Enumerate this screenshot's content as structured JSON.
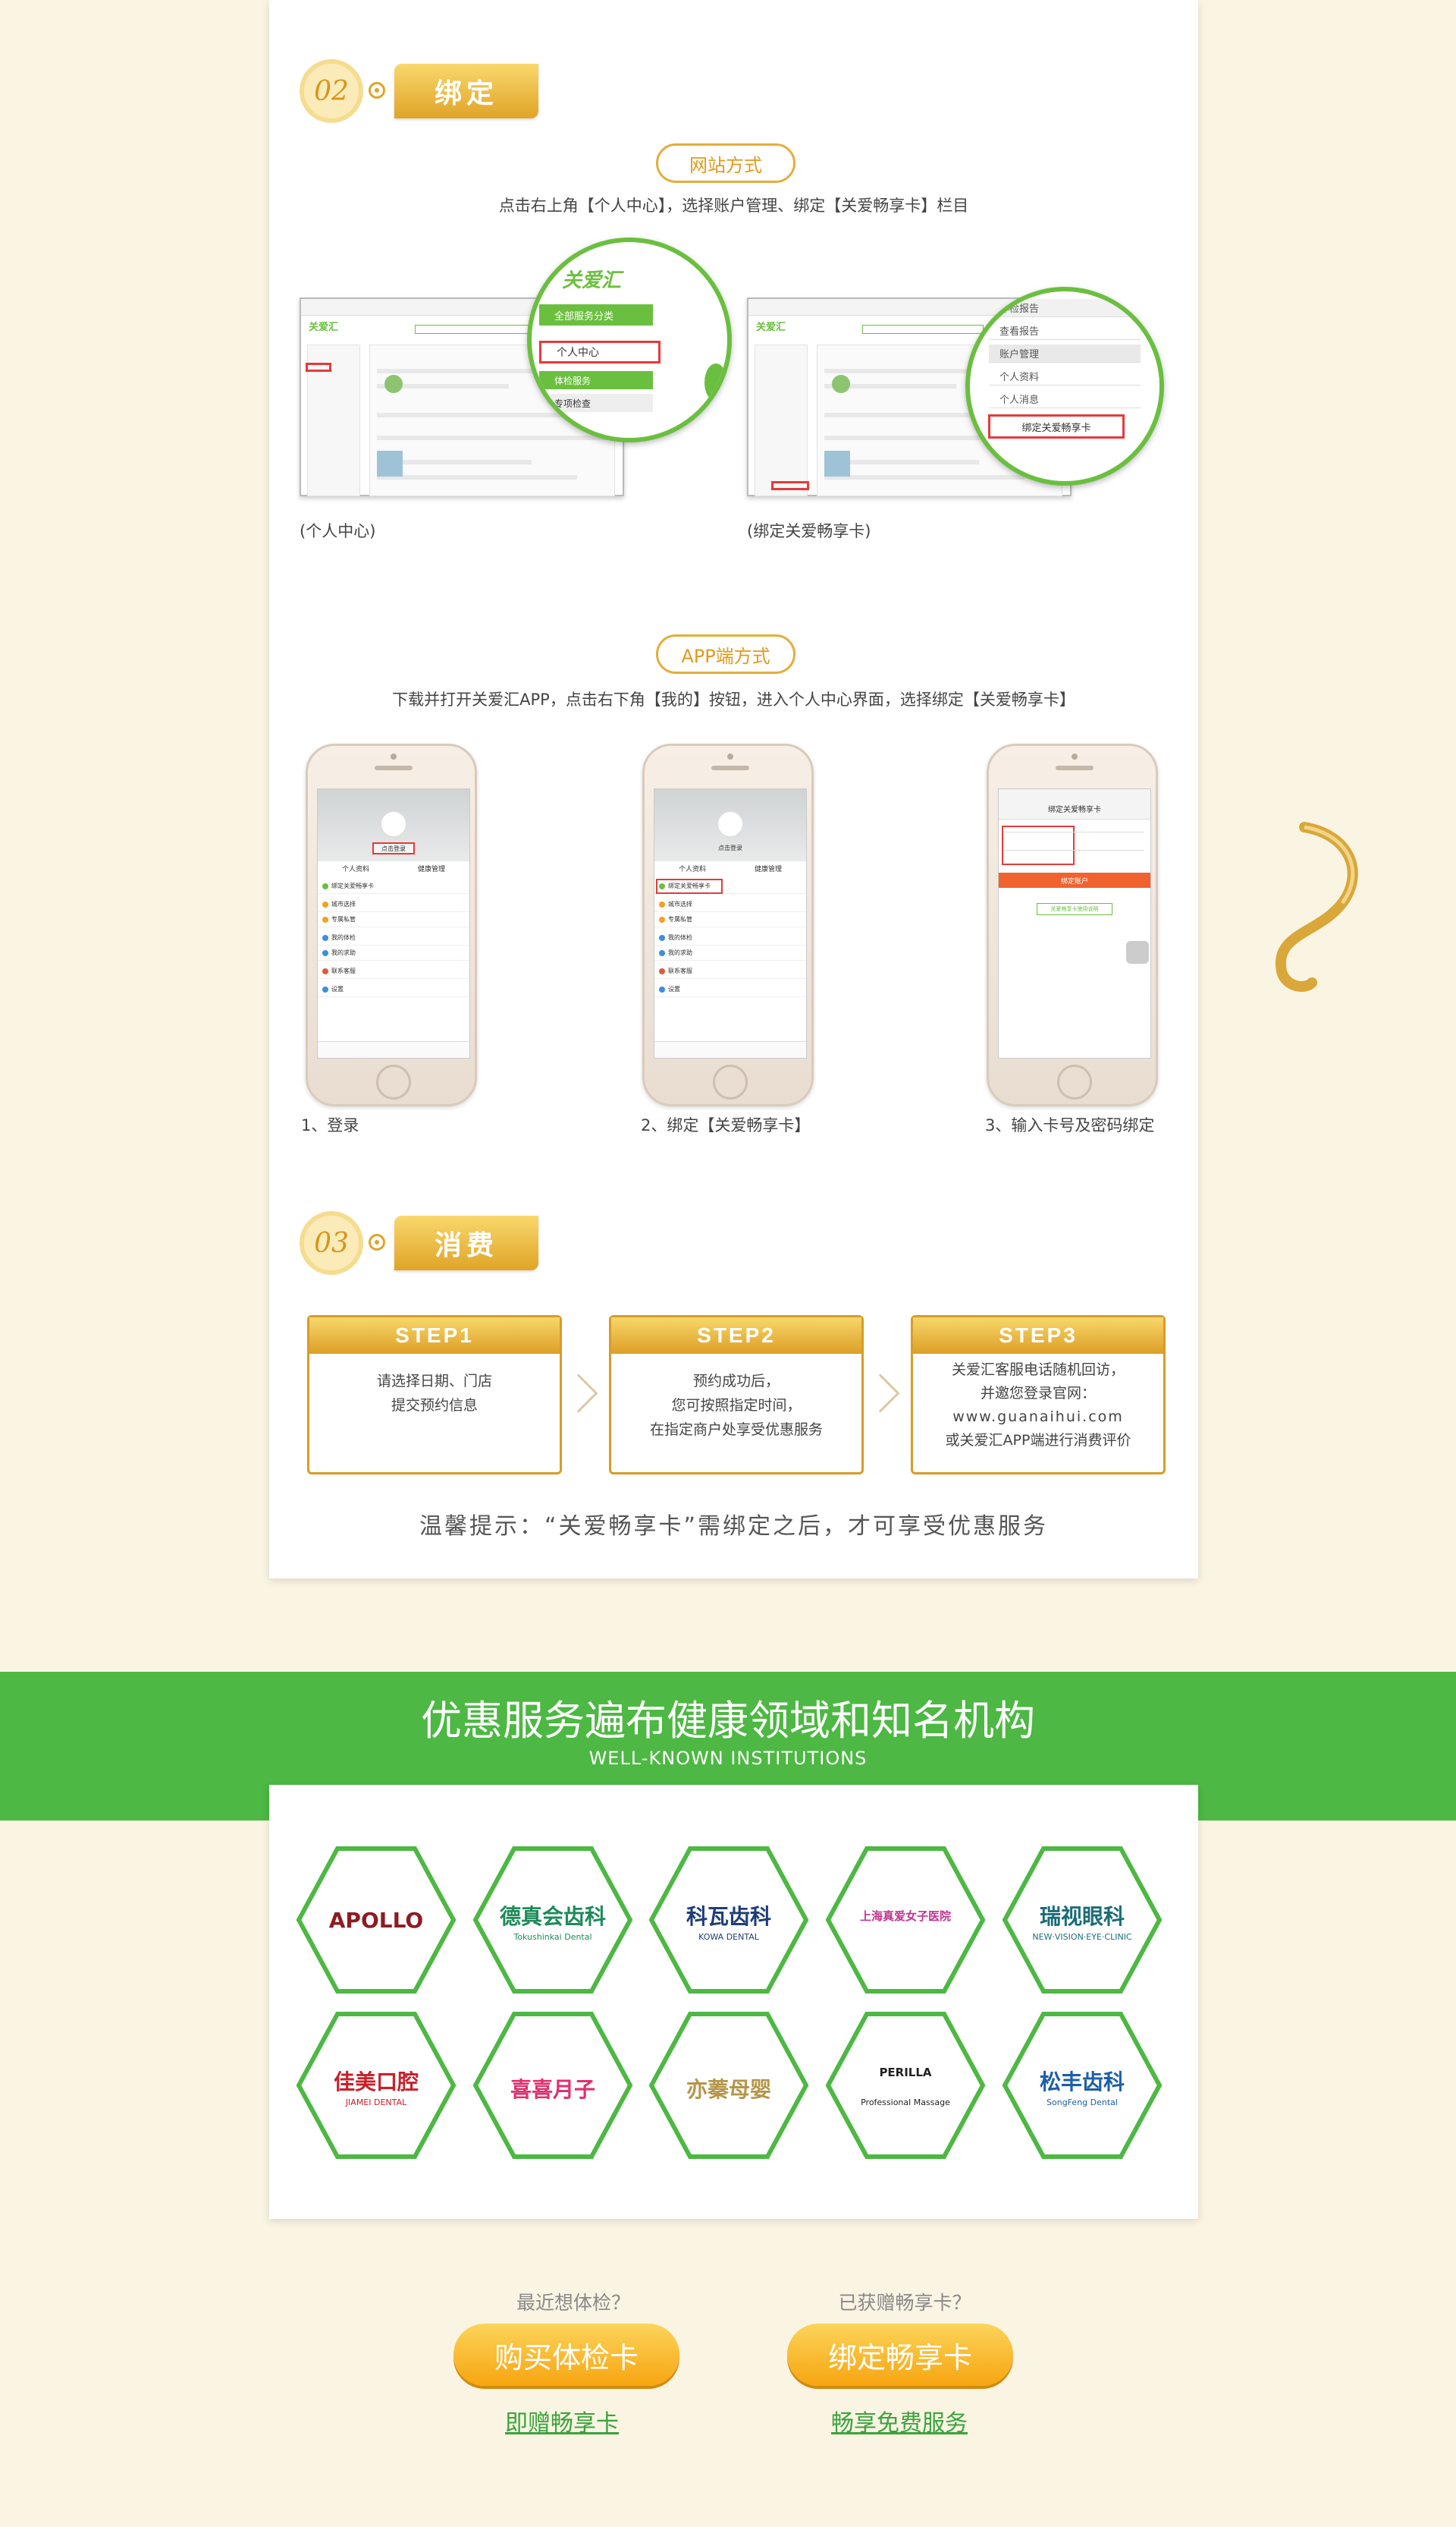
{
  "section2": {
    "num": "02",
    "title": "绑定"
  },
  "web": {
    "pill": "网站方式",
    "desc": "点击右上角【个人中心】，选择账户管理、绑定【关爱畅享卡】栏目",
    "shot1": {
      "caption": "(个人中心)",
      "logo": "关爱汇",
      "menu": [
        "全部服务分类",
        "个人中心",
        "体检服务",
        "专项检查"
      ]
    },
    "shot2": {
      "caption": "(绑定关爱畅享卡)",
      "menu": [
        "体检报告",
        "查看报告",
        "账户管理",
        "个人资料",
        "个人消息",
        "绑定关爱畅享卡"
      ]
    }
  },
  "app": {
    "pill": "APP端方式",
    "desc": "下载并打开关爱汇APP，点击右下角【我的】按钮，进入个人中心界面，选择绑定【关爱畅享卡】",
    "phones": [
      {
        "caption": "1、登录",
        "login": "点击登录",
        "tabs": [
          "个人资料",
          "健康管理"
        ],
        "rows": [
          "绑定关爱畅享卡",
          "城市选择",
          "专属私管",
          "我的体检",
          "我的求助",
          "联系客服",
          "设置"
        ]
      },
      {
        "caption": "2、绑定【关爱畅享卡】",
        "login": "点击登录",
        "tabs": [
          "个人资料",
          "健康管理"
        ],
        "rows": [
          "绑定关爱畅享卡",
          "城市选择",
          "专属私管",
          "我的体检",
          "我的求助",
          "联系客服",
          "设置"
        ]
      },
      {
        "caption": "3、输入卡号及密码绑定",
        "header": "绑定关爱畅享卡",
        "button": "绑定账户",
        "link": "关爱畅享卡使用说明"
      }
    ]
  },
  "section3": {
    "num": "03",
    "title": "消费"
  },
  "steps": [
    {
      "label": "STEP1",
      "lines": [
        "请选择日期、门店",
        "提交预约信息"
      ]
    },
    {
      "label": "STEP2",
      "lines": [
        "预约成功后，",
        "您可按照指定时间，",
        "在指定商户处享受优惠服务"
      ]
    },
    {
      "label": "STEP3",
      "lines": [
        "关爱汇客服电话随机回访，",
        "并邀您登录官网：",
        "www.guanaihui.com",
        "或关爱汇APP端进行消费评价"
      ]
    }
  ],
  "tip": "温馨提示：“关爱畅享卡”需绑定之后，才可享受优惠服务",
  "banner": {
    "title": "优惠服务遍布健康领域和知名机构",
    "subtitle": "WELL-KNOWN INSTITUTIONS"
  },
  "institutions": [
    {
      "name": "APOLLO",
      "color": "#8b1d22"
    },
    {
      "name": "德真会齿科",
      "sub": "Tokushinkai Dental",
      "color": "#1d8a5a"
    },
    {
      "name": "科瓦齿科",
      "sub": "KOWA DENTAL",
      "color": "#1f3d7a"
    },
    {
      "name": "上海真爱女子医院",
      "color": "#c2338f"
    },
    {
      "name": "瑞视眼科",
      "sub": "NEW·VISION·EYE·CLINIC",
      "color": "#1b6c78"
    },
    {
      "name": "佳美口腔",
      "sub": "JIAMEI DENTAL",
      "color": "#c8202a"
    },
    {
      "name": "喜喜月子",
      "color": "#e0306e"
    },
    {
      "name": "亦蓁母婴",
      "color": "#b5954a"
    },
    {
      "name": "PERILLA",
      "sub": "Professional Massage",
      "color": "#222"
    },
    {
      "name": "松丰齿科",
      "sub": "SongFeng Dental",
      "color": "#1d5fa8"
    }
  ],
  "cta": [
    {
      "question": "最近想体检？",
      "button": "购买体检卡",
      "link": "即赠畅享卡"
    },
    {
      "question": "已获赠畅享卡？",
      "button": "绑定畅享卡",
      "link": "畅享免费服务"
    }
  ]
}
